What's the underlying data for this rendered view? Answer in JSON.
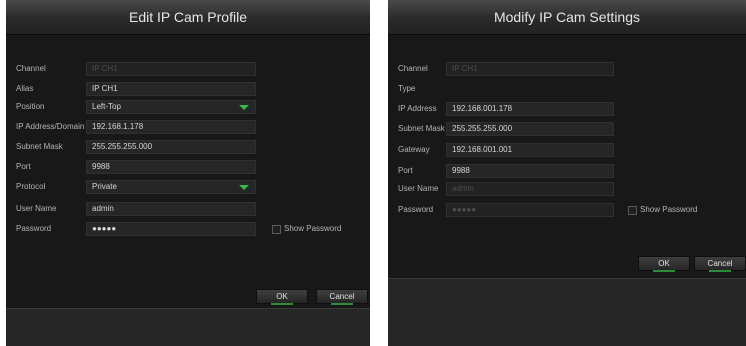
{
  "edit_dialog": {
    "title": "Edit IP Cam Profile",
    "labels": {
      "channel": "Channel",
      "alias": "Alias",
      "position": "Position",
      "ip_domain": "IP Address/Domain",
      "subnet": "Subnet Mask",
      "port": "Port",
      "protocol": "Protocol",
      "user": "User Name",
      "password": "Password"
    },
    "values": {
      "channel": "IP CH1",
      "alias": "IP CH1",
      "position": "Left-Top",
      "ip_domain": "192.168.1.178",
      "subnet": "255.255.255.000",
      "port": "9988",
      "protocol": "Private",
      "user": "admin",
      "password": "●●●●●"
    },
    "show_password": "Show Password",
    "ok": "OK",
    "cancel": "Cancel"
  },
  "modify_dialog": {
    "title": "Modify IP Cam Settings",
    "labels": {
      "channel": "Channel",
      "type": "Type",
      "ip": "IP Address",
      "subnet": "Subnet Mask",
      "gateway": "Gateway",
      "port": "Port",
      "user": "User Name",
      "password": "Password"
    },
    "values": {
      "channel": "IP CH1",
      "ip": "192.168.001.178",
      "subnet": "255.255.255.000",
      "gateway": "192.168.001.001",
      "port": "9988",
      "user": "admin",
      "password": "●●●●●"
    },
    "show_password": "Show Password",
    "ok": "OK",
    "cancel": "Cancel"
  },
  "colors": {
    "dropdown_arrow": "#33b94a",
    "button_glow": "#2e8b3c"
  }
}
